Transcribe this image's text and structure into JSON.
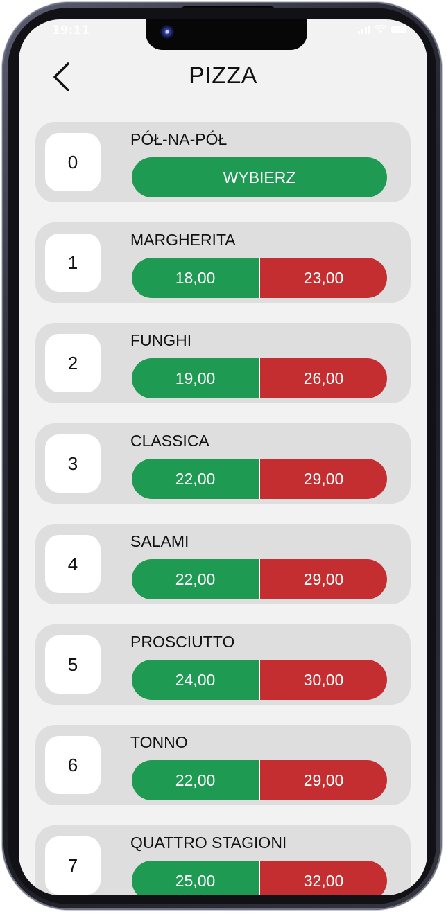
{
  "status": {
    "time": "19:11"
  },
  "header": {
    "title": "PIZZA",
    "back_icon": "chevron-left-icon"
  },
  "colors": {
    "green": "#1f9a53",
    "red": "#c42e30",
    "card": "#dedede",
    "screen": "#f2f2f2"
  },
  "items": [
    {
      "number": "0",
      "name": "PÓŁ-NA-PÓŁ",
      "action_label": "WYBIERZ"
    },
    {
      "number": "1",
      "name": "MARGHERITA",
      "price_small": "18,00",
      "price_large": "23,00"
    },
    {
      "number": "2",
      "name": "FUNGHI",
      "price_small": "19,00",
      "price_large": "26,00"
    },
    {
      "number": "3",
      "name": "CLASSICA",
      "price_small": "22,00",
      "price_large": "29,00"
    },
    {
      "number": "4",
      "name": "SALAMI",
      "price_small": "22,00",
      "price_large": "29,00"
    },
    {
      "number": "5",
      "name": "PROSCIUTTO",
      "price_small": "24,00",
      "price_large": "30,00"
    },
    {
      "number": "6",
      "name": "TONNO",
      "price_small": "22,00",
      "price_large": "29,00"
    },
    {
      "number": "7",
      "name": "QUATTRO STAGIONI",
      "price_small": "25,00",
      "price_large": "32,00"
    }
  ]
}
